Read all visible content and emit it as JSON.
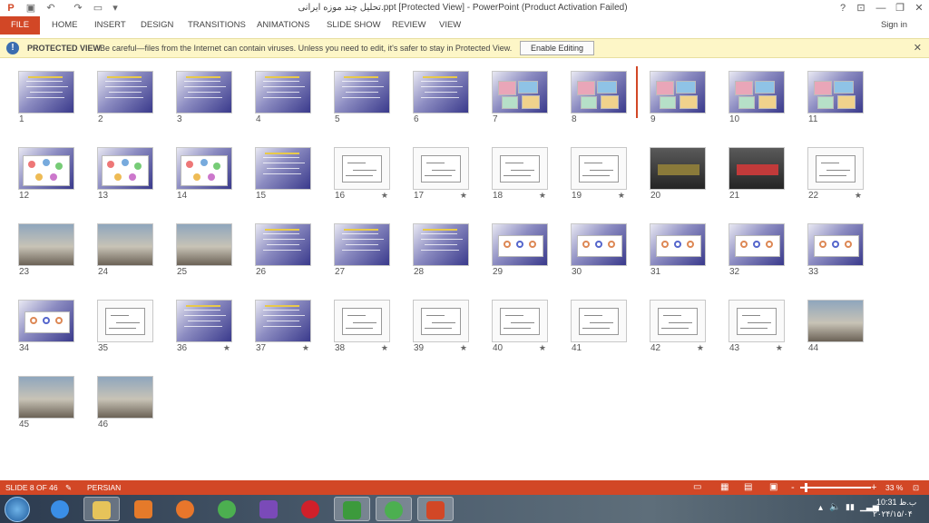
{
  "window": {
    "title": "تحلیل چند موزه ایرانی.ppt [Protected View] - PowerPoint (Product Activation Failed)",
    "controls": {
      "help": "?",
      "restore_ribbon": "⊡",
      "minimize": "—",
      "maximize": "❐",
      "close": "✕"
    }
  },
  "quick_access": {
    "app_icon": "powerpoint-icon",
    "save": "save-icon",
    "undo": "undo-icon",
    "redo": "redo-icon",
    "start": "start-from-beginning-icon"
  },
  "ribbon": {
    "file": "FILE",
    "tabs": [
      "HOME",
      "INSERT",
      "DESIGN",
      "TRANSITIONS",
      "ANIMATIONS",
      "SLIDE SHOW",
      "REVIEW",
      "VIEW"
    ],
    "sign_in": "Sign in"
  },
  "protected_view": {
    "title": "PROTECTED VIEW",
    "message": "Be careful—files from the Internet can contain viruses. Unless you need to edit, it's safer to stay in Protected View.",
    "button": "Enable Editing",
    "close": "✕"
  },
  "slides": [
    {
      "n": "1",
      "star": ""
    },
    {
      "n": "2",
      "star": ""
    },
    {
      "n": "3",
      "star": ""
    },
    {
      "n": "4",
      "star": ""
    },
    {
      "n": "5",
      "star": ""
    },
    {
      "n": "6",
      "star": ""
    },
    {
      "n": "7",
      "star": ""
    },
    {
      "n": "8",
      "star": ""
    },
    {
      "n": "9",
      "star": ""
    },
    {
      "n": "10",
      "star": ""
    },
    {
      "n": "11",
      "star": ""
    },
    {
      "n": "12",
      "star": ""
    },
    {
      "n": "13",
      "star": ""
    },
    {
      "n": "14",
      "star": ""
    },
    {
      "n": "15",
      "star": ""
    },
    {
      "n": "16",
      "star": "★"
    },
    {
      "n": "17",
      "star": "★"
    },
    {
      "n": "18",
      "star": "★"
    },
    {
      "n": "19",
      "star": "★"
    },
    {
      "n": "20",
      "star": ""
    },
    {
      "n": "21",
      "star": ""
    },
    {
      "n": "22",
      "star": "★"
    },
    {
      "n": "23",
      "star": ""
    },
    {
      "n": "24",
      "star": ""
    },
    {
      "n": "25",
      "star": ""
    },
    {
      "n": "26",
      "star": ""
    },
    {
      "n": "27",
      "star": ""
    },
    {
      "n": "28",
      "star": ""
    },
    {
      "n": "29",
      "star": ""
    },
    {
      "n": "30",
      "star": ""
    },
    {
      "n": "31",
      "star": ""
    },
    {
      "n": "32",
      "star": ""
    },
    {
      "n": "33",
      "star": ""
    },
    {
      "n": "34",
      "star": ""
    },
    {
      "n": "35",
      "star": ""
    },
    {
      "n": "36",
      "star": "★"
    },
    {
      "n": "37",
      "star": "★"
    },
    {
      "n": "38",
      "star": "★"
    },
    {
      "n": "39",
      "star": "★"
    },
    {
      "n": "40",
      "star": "★"
    },
    {
      "n": "41",
      "star": ""
    },
    {
      "n": "42",
      "star": "★"
    },
    {
      "n": "43",
      "star": "★"
    },
    {
      "n": "44",
      "star": ""
    },
    {
      "n": "45",
      "star": ""
    },
    {
      "n": "46",
      "star": ""
    }
  ],
  "status": {
    "slide_counter": "SLIDE 8 OF 46",
    "language": "PERSIAN",
    "zoom_minus": "-",
    "zoom_plus": "+",
    "zoom_level": "33 %",
    "zoom_fraction": 0.33
  },
  "taskbar": {
    "apps": [
      "internet-explorer-icon",
      "file-explorer-icon",
      "media-player-icon",
      "firefox-icon",
      "chrome-icon",
      "visual-studio-icon",
      "opera-icon",
      "idm-icon",
      "chrome-icon",
      "powerpoint-icon"
    ],
    "clock_time": "ب.ظ 10:31",
    "clock_date": "۲۰۲۴/۱۵/۰۴"
  }
}
